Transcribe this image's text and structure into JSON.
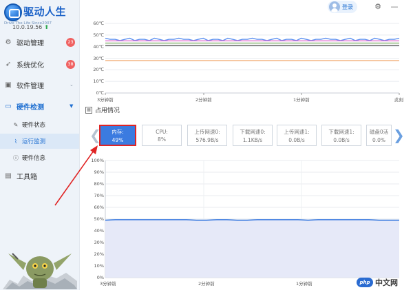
{
  "brand": {
    "title": "驱动人生",
    "subtitle": "Drive The Life  Since2007",
    "version": "10.0.19.56",
    "logo_icon": "steering-wheel-icon",
    "update_icon": "update-arrow-icon"
  },
  "sidebar": {
    "items": [
      {
        "label": "驱动管理",
        "icon": "gear-icon",
        "badge": "23"
      },
      {
        "label": "系统优化",
        "icon": "rocket-icon",
        "badge": "38"
      },
      {
        "label": "软件管理",
        "icon": "bag-icon",
        "expand": "chevron-down"
      },
      {
        "label": "硬件检测",
        "icon": "monitor-icon",
        "expand": "caret-down",
        "active": true
      },
      {
        "label": "工具箱",
        "icon": "toolbox-icon"
      }
    ],
    "sub_items": [
      {
        "label": "硬件状态",
        "icon": "pen-icon"
      },
      {
        "label": "运行监测",
        "icon": "line-chart-icon",
        "active": true
      },
      {
        "label": "硬件信息",
        "icon": "info-icon"
      }
    ]
  },
  "topbar": {
    "login_label": "登录",
    "settings_icon": "gear-icon",
    "minimize_icon": "minimize-icon"
  },
  "temp_chart": {
    "y_ticks": [
      "60℃",
      "50℃",
      "40℃",
      "30℃",
      "20℃",
      "10℃",
      "0℃"
    ],
    "x_ticks": [
      "3分钟前",
      "2分钟前",
      "1分钟前",
      "此刻"
    ],
    "series": [
      {
        "color": "#5b8ff0",
        "value": 46
      },
      {
        "color": "#e070d2",
        "value": 45
      },
      {
        "color": "#7fb06a",
        "value": 43
      },
      {
        "color": "#8a8a8a",
        "value": 41
      },
      {
        "color": "#f2b07a",
        "value": 28
      }
    ],
    "ylim": [
      0,
      60
    ]
  },
  "usage": {
    "title": "占用情况",
    "metrics": [
      {
        "label": "内存:",
        "value": "49%",
        "selected": true
      },
      {
        "label": "CPU:",
        "value": "8%"
      },
      {
        "label": "上传网速0:",
        "value": "576.9B/s"
      },
      {
        "label": "下载网速0:",
        "value": "1.1KB/s"
      },
      {
        "label": "上传网速1:",
        "value": "0.0B/s"
      },
      {
        "label": "下载网速1:",
        "value": "0.0B/s"
      },
      {
        "label": "磁盘0活",
        "value": "0.0%"
      }
    ]
  },
  "chart_data": {
    "type": "area",
    "ylim": [
      0,
      100
    ],
    "y_ticks": [
      "100%",
      "90%",
      "80%",
      "70%",
      "60%",
      "50%",
      "40%",
      "30%",
      "20%",
      "10%",
      "0%"
    ],
    "x_ticks": [
      "3分钟前",
      "2分钟前",
      "1分钟前"
    ],
    "series": [
      {
        "values": [
          49,
          49.5,
          49.5,
          49.5,
          49.5,
          49.5,
          49.5,
          49.5,
          49.5,
          49,
          49,
          49.5,
          49.5,
          49,
          49,
          49.5,
          49.5,
          49.5,
          49.5,
          49.5,
          49,
          49.5,
          49.5,
          49.5,
          49.5,
          49.5,
          49.5,
          49,
          49,
          49
        ]
      }
    ],
    "line_color": "#3b7be0",
    "fill_color": "#e6e9f8",
    "grid": true
  },
  "watermark": {
    "badge": "php",
    "text": "中文网"
  }
}
